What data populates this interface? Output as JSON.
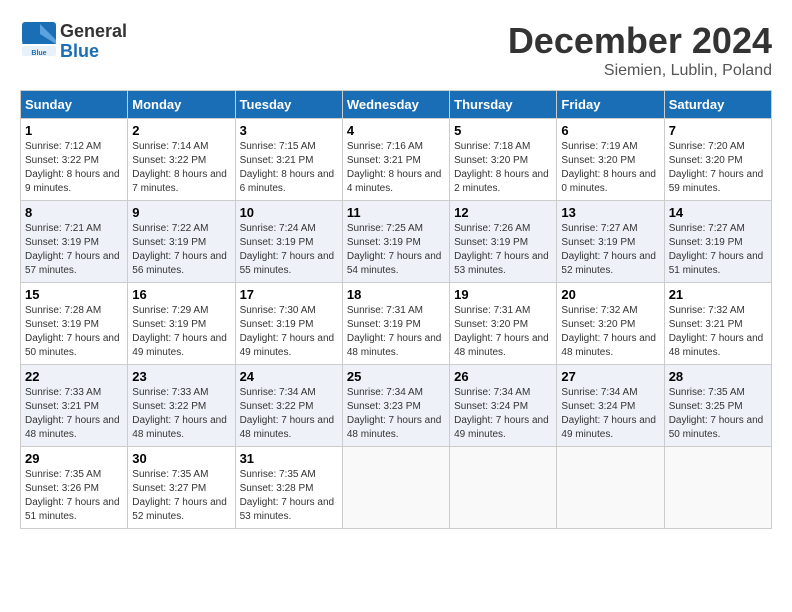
{
  "header": {
    "logo_line1": "General",
    "logo_line2": "Blue",
    "month": "December 2024",
    "location": "Siemien, Lublin, Poland"
  },
  "weekdays": [
    "Sunday",
    "Monday",
    "Tuesday",
    "Wednesday",
    "Thursday",
    "Friday",
    "Saturday"
  ],
  "weeks": [
    [
      {
        "day": "1",
        "sunrise": "7:12 AM",
        "sunset": "3:22 PM",
        "daylight": "8 hours and 9 minutes."
      },
      {
        "day": "2",
        "sunrise": "7:14 AM",
        "sunset": "3:22 PM",
        "daylight": "8 hours and 7 minutes."
      },
      {
        "day": "3",
        "sunrise": "7:15 AM",
        "sunset": "3:21 PM",
        "daylight": "8 hours and 6 minutes."
      },
      {
        "day": "4",
        "sunrise": "7:16 AM",
        "sunset": "3:21 PM",
        "daylight": "8 hours and 4 minutes."
      },
      {
        "day": "5",
        "sunrise": "7:18 AM",
        "sunset": "3:20 PM",
        "daylight": "8 hours and 2 minutes."
      },
      {
        "day": "6",
        "sunrise": "7:19 AM",
        "sunset": "3:20 PM",
        "daylight": "8 hours and 0 minutes."
      },
      {
        "day": "7",
        "sunrise": "7:20 AM",
        "sunset": "3:20 PM",
        "daylight": "7 hours and 59 minutes."
      }
    ],
    [
      {
        "day": "8",
        "sunrise": "7:21 AM",
        "sunset": "3:19 PM",
        "daylight": "7 hours and 57 minutes."
      },
      {
        "day": "9",
        "sunrise": "7:22 AM",
        "sunset": "3:19 PM",
        "daylight": "7 hours and 56 minutes."
      },
      {
        "day": "10",
        "sunrise": "7:24 AM",
        "sunset": "3:19 PM",
        "daylight": "7 hours and 55 minutes."
      },
      {
        "day": "11",
        "sunrise": "7:25 AM",
        "sunset": "3:19 PM",
        "daylight": "7 hours and 54 minutes."
      },
      {
        "day": "12",
        "sunrise": "7:26 AM",
        "sunset": "3:19 PM",
        "daylight": "7 hours and 53 minutes."
      },
      {
        "day": "13",
        "sunrise": "7:27 AM",
        "sunset": "3:19 PM",
        "daylight": "7 hours and 52 minutes."
      },
      {
        "day": "14",
        "sunrise": "7:27 AM",
        "sunset": "3:19 PM",
        "daylight": "7 hours and 51 minutes."
      }
    ],
    [
      {
        "day": "15",
        "sunrise": "7:28 AM",
        "sunset": "3:19 PM",
        "daylight": "7 hours and 50 minutes."
      },
      {
        "day": "16",
        "sunrise": "7:29 AM",
        "sunset": "3:19 PM",
        "daylight": "7 hours and 49 minutes."
      },
      {
        "day": "17",
        "sunrise": "7:30 AM",
        "sunset": "3:19 PM",
        "daylight": "7 hours and 49 minutes."
      },
      {
        "day": "18",
        "sunrise": "7:31 AM",
        "sunset": "3:19 PM",
        "daylight": "7 hours and 48 minutes."
      },
      {
        "day": "19",
        "sunrise": "7:31 AM",
        "sunset": "3:20 PM",
        "daylight": "7 hours and 48 minutes."
      },
      {
        "day": "20",
        "sunrise": "7:32 AM",
        "sunset": "3:20 PM",
        "daylight": "7 hours and 48 minutes."
      },
      {
        "day": "21",
        "sunrise": "7:32 AM",
        "sunset": "3:21 PM",
        "daylight": "7 hours and 48 minutes."
      }
    ],
    [
      {
        "day": "22",
        "sunrise": "7:33 AM",
        "sunset": "3:21 PM",
        "daylight": "7 hours and 48 minutes."
      },
      {
        "day": "23",
        "sunrise": "7:33 AM",
        "sunset": "3:22 PM",
        "daylight": "7 hours and 48 minutes."
      },
      {
        "day": "24",
        "sunrise": "7:34 AM",
        "sunset": "3:22 PM",
        "daylight": "7 hours and 48 minutes."
      },
      {
        "day": "25",
        "sunrise": "7:34 AM",
        "sunset": "3:23 PM",
        "daylight": "7 hours and 48 minutes."
      },
      {
        "day": "26",
        "sunrise": "7:34 AM",
        "sunset": "3:24 PM",
        "daylight": "7 hours and 49 minutes."
      },
      {
        "day": "27",
        "sunrise": "7:34 AM",
        "sunset": "3:24 PM",
        "daylight": "7 hours and 49 minutes."
      },
      {
        "day": "28",
        "sunrise": "7:35 AM",
        "sunset": "3:25 PM",
        "daylight": "7 hours and 50 minutes."
      }
    ],
    [
      {
        "day": "29",
        "sunrise": "7:35 AM",
        "sunset": "3:26 PM",
        "daylight": "7 hours and 51 minutes."
      },
      {
        "day": "30",
        "sunrise": "7:35 AM",
        "sunset": "3:27 PM",
        "daylight": "7 hours and 52 minutes."
      },
      {
        "day": "31",
        "sunrise": "7:35 AM",
        "sunset": "3:28 PM",
        "daylight": "7 hours and 53 minutes."
      },
      null,
      null,
      null,
      null
    ]
  ],
  "labels": {
    "sunrise": "Sunrise:",
    "sunset": "Sunset:",
    "daylight": "Daylight:"
  }
}
